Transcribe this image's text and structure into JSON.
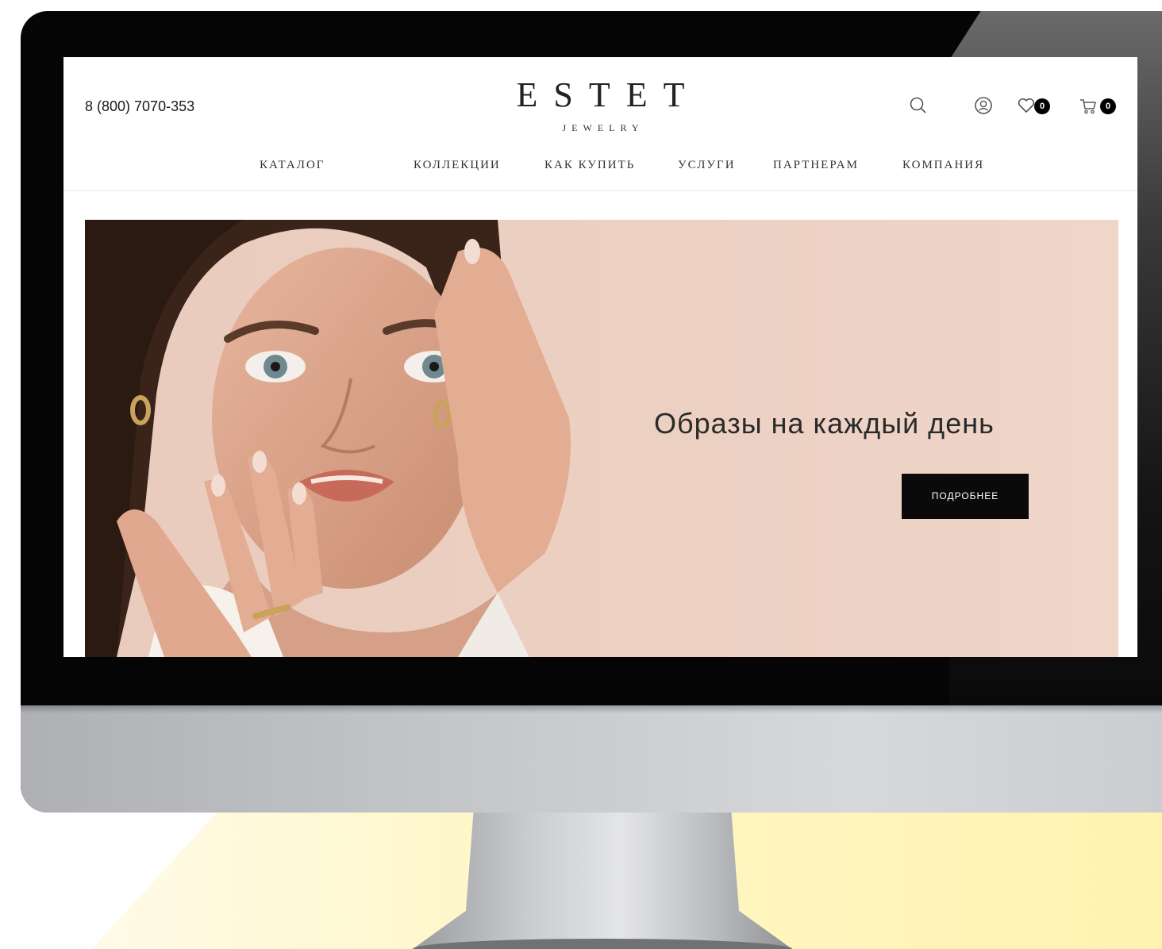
{
  "header": {
    "phone": "8 (800) 7070-353",
    "logo_main": "ESTET",
    "logo_sub": "JEWELRY",
    "favorites_count": "0",
    "cart_count": "0"
  },
  "nav": {
    "items": [
      {
        "label": "КАТАЛОГ"
      },
      {
        "label": "КОЛЛЕКЦИИ"
      },
      {
        "label": "КАК КУПИТЬ"
      },
      {
        "label": "УСЛУГИ"
      },
      {
        "label": "ПАРТНЕРАМ"
      },
      {
        "label": "КОМПАНИЯ"
      }
    ]
  },
  "banner": {
    "headline": "Образы на каждый день",
    "cta_label": "ПОДРОБНЕЕ"
  },
  "icons": [
    "search-icon",
    "account-icon",
    "heart-icon",
    "cart-icon"
  ],
  "colors": {
    "banner_bg": "#ecd1c3",
    "cta_bg": "#0a0a0a",
    "badge_bg": "#000000"
  }
}
